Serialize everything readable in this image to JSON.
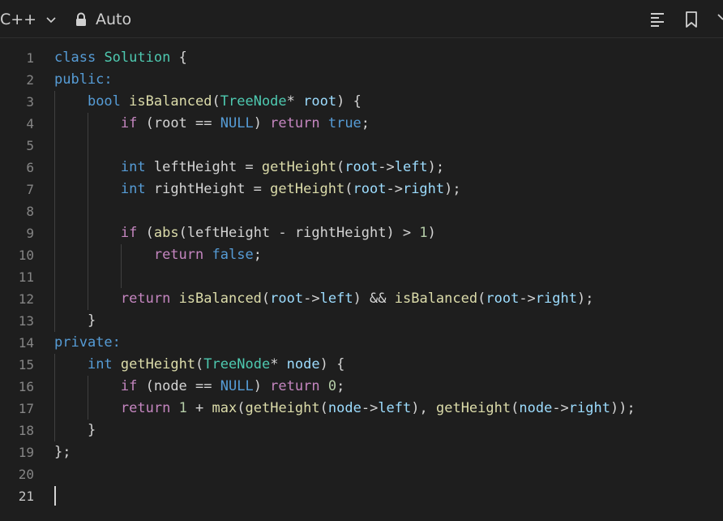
{
  "toolbar": {
    "language": "C++",
    "mode": "Auto",
    "icons": [
      "chevron-down-icon",
      "lock-icon",
      "format-icon",
      "bookmark-icon"
    ]
  },
  "editor": {
    "lines": [
      {
        "n": "1",
        "tokens": [
          [
            "kw",
            "class"
          ],
          [
            "op",
            " "
          ],
          [
            "ty",
            "Solution"
          ],
          [
            "op",
            " {"
          ]
        ]
      },
      {
        "n": "2",
        "tokens": [
          [
            "kw",
            "public:"
          ]
        ]
      },
      {
        "n": "3",
        "tokens": [
          [
            "op",
            "    "
          ],
          [
            "kw",
            "bool"
          ],
          [
            "op",
            " "
          ],
          [
            "fn",
            "isBalanced"
          ],
          [
            "op",
            "("
          ],
          [
            "ty",
            "TreeNode"
          ],
          [
            "op",
            "* "
          ],
          [
            "vr",
            "root"
          ],
          [
            "op",
            ") {"
          ]
        ]
      },
      {
        "n": "4",
        "tokens": [
          [
            "op",
            "        "
          ],
          [
            "ctl",
            "if"
          ],
          [
            "op",
            " (root == "
          ],
          [
            "kw",
            "NULL"
          ],
          [
            "op",
            ") "
          ],
          [
            "ctl",
            "return"
          ],
          [
            "op",
            " "
          ],
          [
            "kw",
            "true"
          ],
          [
            "op",
            ";"
          ]
        ]
      },
      {
        "n": "5",
        "tokens": []
      },
      {
        "n": "6",
        "tokens": [
          [
            "op",
            "        "
          ],
          [
            "kw",
            "int"
          ],
          [
            "op",
            " leftHeight = "
          ],
          [
            "fn",
            "getHeight"
          ],
          [
            "op",
            "("
          ],
          [
            "vr",
            "root"
          ],
          [
            "op",
            "->"
          ],
          [
            "vr",
            "left"
          ],
          [
            "op",
            ");"
          ]
        ]
      },
      {
        "n": "7",
        "tokens": [
          [
            "op",
            "        "
          ],
          [
            "kw",
            "int"
          ],
          [
            "op",
            " rightHeight = "
          ],
          [
            "fn",
            "getHeight"
          ],
          [
            "op",
            "("
          ],
          [
            "vr",
            "root"
          ],
          [
            "op",
            "->"
          ],
          [
            "vr",
            "right"
          ],
          [
            "op",
            ");"
          ]
        ]
      },
      {
        "n": "8",
        "tokens": []
      },
      {
        "n": "9",
        "tokens": [
          [
            "op",
            "        "
          ],
          [
            "ctl",
            "if"
          ],
          [
            "op",
            " ("
          ],
          [
            "fn",
            "abs"
          ],
          [
            "op",
            "(leftHeight - rightHeight) > "
          ],
          [
            "nm",
            "1"
          ],
          [
            "op",
            ")"
          ]
        ]
      },
      {
        "n": "10",
        "tokens": [
          [
            "op",
            "            "
          ],
          [
            "ctl",
            "return"
          ],
          [
            "op",
            " "
          ],
          [
            "kw",
            "false"
          ],
          [
            "op",
            ";"
          ]
        ]
      },
      {
        "n": "11",
        "tokens": []
      },
      {
        "n": "12",
        "tokens": [
          [
            "op",
            "        "
          ],
          [
            "ctl",
            "return"
          ],
          [
            "op",
            " "
          ],
          [
            "fn",
            "isBalanced"
          ],
          [
            "op",
            "("
          ],
          [
            "vr",
            "root"
          ],
          [
            "op",
            "->"
          ],
          [
            "vr",
            "left"
          ],
          [
            "op",
            ") && "
          ],
          [
            "fn",
            "isBalanced"
          ],
          [
            "op",
            "("
          ],
          [
            "vr",
            "root"
          ],
          [
            "op",
            "->"
          ],
          [
            "vr",
            "right"
          ],
          [
            "op",
            ");"
          ]
        ]
      },
      {
        "n": "13",
        "tokens": [
          [
            "op",
            "    }"
          ]
        ]
      },
      {
        "n": "14",
        "tokens": [
          [
            "kw",
            "private:"
          ]
        ]
      },
      {
        "n": "15",
        "tokens": [
          [
            "op",
            "    "
          ],
          [
            "kw",
            "int"
          ],
          [
            "op",
            " "
          ],
          [
            "fn",
            "getHeight"
          ],
          [
            "op",
            "("
          ],
          [
            "ty",
            "TreeNode"
          ],
          [
            "op",
            "* "
          ],
          [
            "vr",
            "node"
          ],
          [
            "op",
            ") {"
          ]
        ]
      },
      {
        "n": "16",
        "tokens": [
          [
            "op",
            "        "
          ],
          [
            "ctl",
            "if"
          ],
          [
            "op",
            " (node == "
          ],
          [
            "kw",
            "NULL"
          ],
          [
            "op",
            ") "
          ],
          [
            "ctl",
            "return"
          ],
          [
            "op",
            " "
          ],
          [
            "nm",
            "0"
          ],
          [
            "op",
            ";"
          ]
        ]
      },
      {
        "n": "17",
        "tokens": [
          [
            "op",
            "        "
          ],
          [
            "ctl",
            "return"
          ],
          [
            "op",
            " "
          ],
          [
            "nm",
            "1"
          ],
          [
            "op",
            " + "
          ],
          [
            "fn",
            "max"
          ],
          [
            "op",
            "("
          ],
          [
            "fn",
            "getHeight"
          ],
          [
            "op",
            "("
          ],
          [
            "vr",
            "node"
          ],
          [
            "op",
            "->"
          ],
          [
            "vr",
            "left"
          ],
          [
            "op",
            "), "
          ],
          [
            "fn",
            "getHeight"
          ],
          [
            "op",
            "("
          ],
          [
            "vr",
            "node"
          ],
          [
            "op",
            "->"
          ],
          [
            "vr",
            "right"
          ],
          [
            "op",
            "));"
          ]
        ]
      },
      {
        "n": "18",
        "tokens": [
          [
            "op",
            "    }"
          ]
        ]
      },
      {
        "n": "19",
        "tokens": [
          [
            "op",
            "};"
          ]
        ]
      },
      {
        "n": "20",
        "tokens": []
      },
      {
        "n": "21",
        "tokens": []
      }
    ],
    "active_line": "21"
  }
}
